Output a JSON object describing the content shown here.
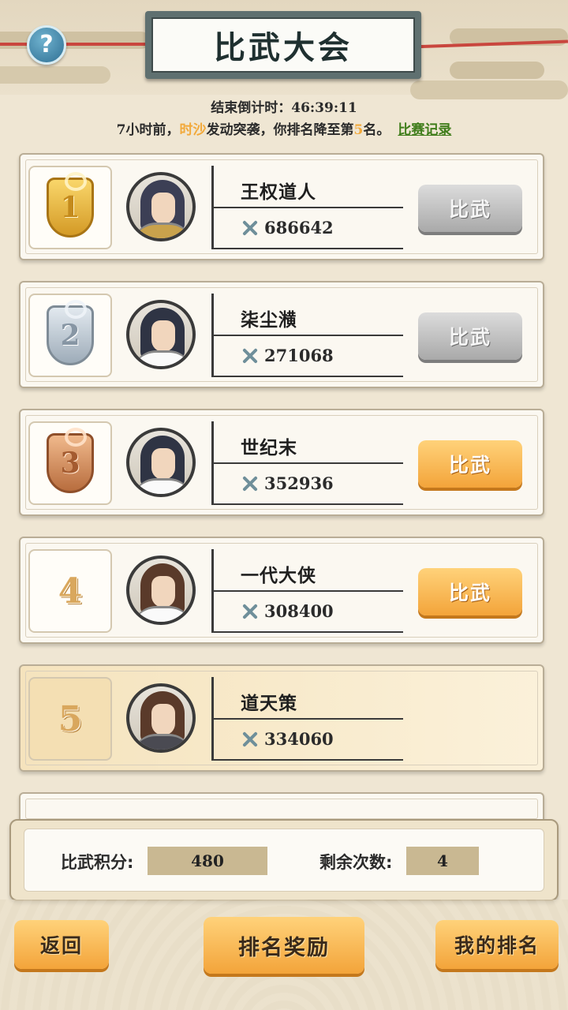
{
  "header": {
    "title": "比武大会",
    "help_label": "?"
  },
  "countdown": {
    "label": "结束倒计时：",
    "value": "46:39:11"
  },
  "notice": {
    "time_ago": "7小时前，",
    "attacker": "时沙",
    "middle": "发动突袭，你排名降至第",
    "rank": "5",
    "suffix": "名。",
    "link_label": "比赛记录"
  },
  "players": [
    {
      "rank": "1",
      "name": "王权道人",
      "power": "686642",
      "button_label": "比武",
      "button_state": "disabled"
    },
    {
      "rank": "2",
      "name": "柒尘㶇",
      "power": "271068",
      "button_label": "比武",
      "button_state": "disabled"
    },
    {
      "rank": "3",
      "name": "世纪末",
      "power": "352936",
      "button_label": "比武",
      "button_state": "active"
    },
    {
      "rank": "4",
      "name": "一代大侠",
      "power": "308400",
      "button_label": "比武",
      "button_state": "active"
    },
    {
      "rank": "5",
      "name": "道天策",
      "power": "334060",
      "is_self": true
    }
  ],
  "stats": {
    "points_label": "比武积分:",
    "points_value": "480",
    "remaining_label": "剩余次数:",
    "remaining_value": "4"
  },
  "footer": {
    "back_label": "返回",
    "rewards_label": "排名奖励",
    "my_rank_label": "我的排名"
  },
  "colors": {
    "accent_orange": "#f3a43a",
    "highlight_name": "#f2a93a",
    "link_green": "#3f7d1a",
    "disabled_gray": "#a9a9a9"
  }
}
